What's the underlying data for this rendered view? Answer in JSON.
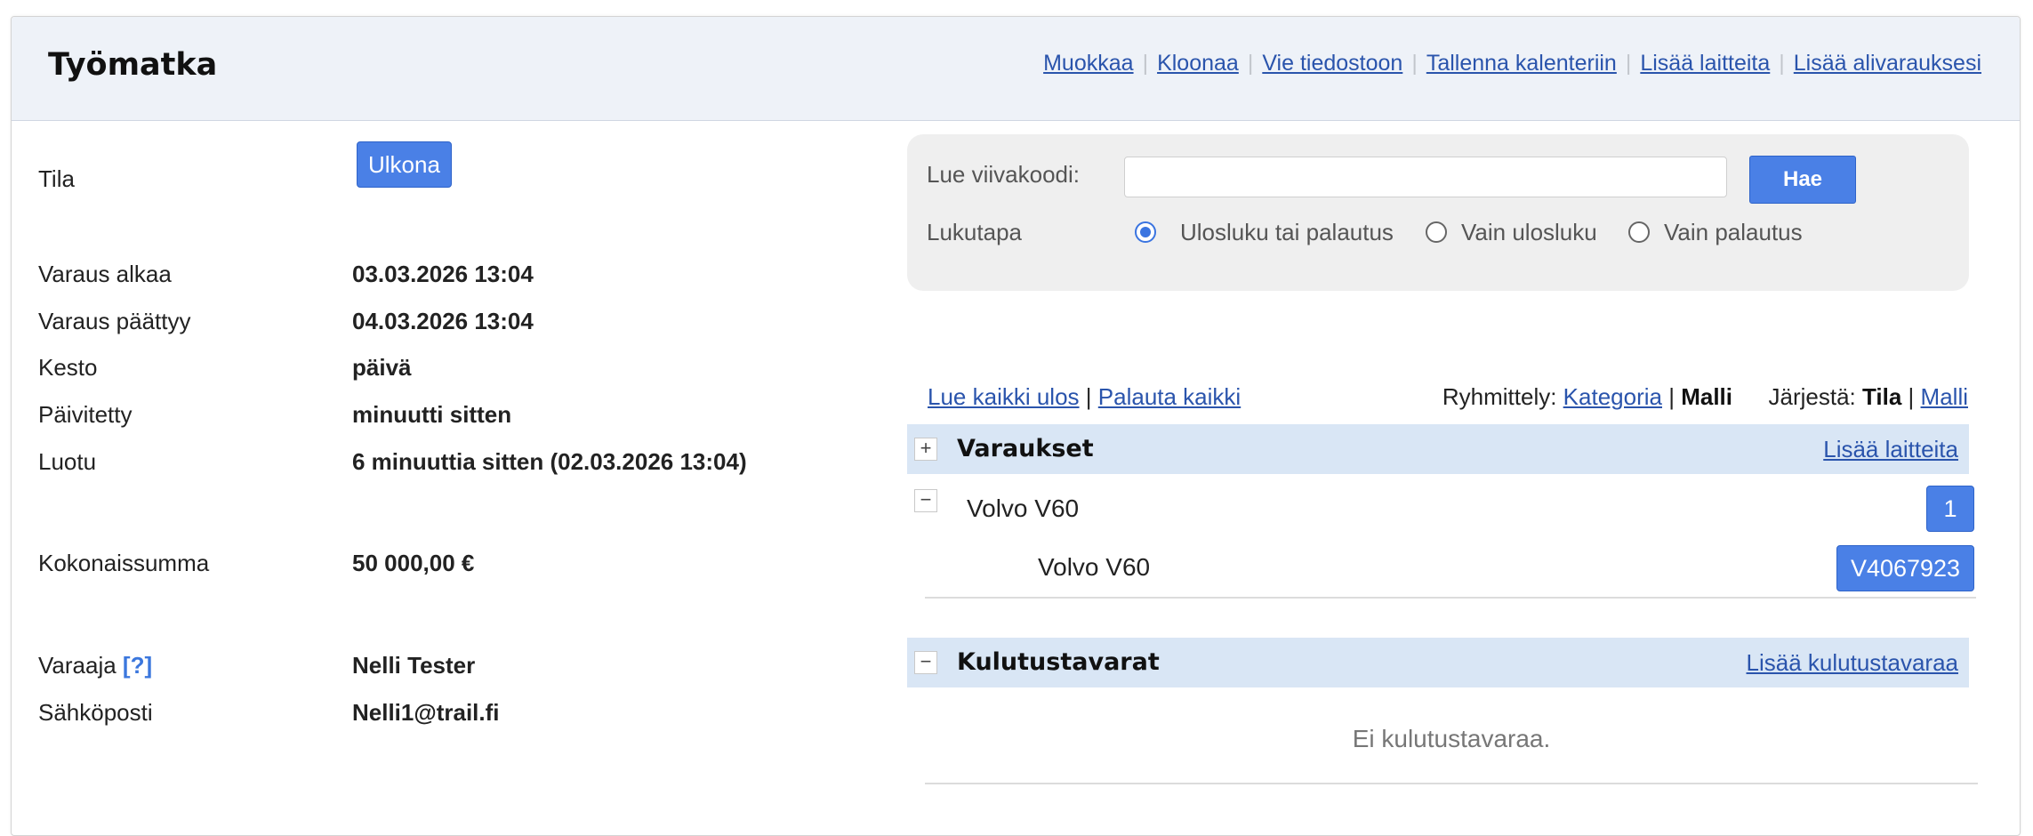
{
  "header": {
    "title": "Työmatka",
    "actions": [
      "Muokkaa",
      "Kloonaa",
      "Vie tiedostoon",
      "Tallenna kalenteriin",
      "Lisää laitteita",
      "Lisää alivarauksesi"
    ]
  },
  "details": {
    "status_label": "Tila",
    "status_value": "Ulkona",
    "start_label": "Varaus alkaa",
    "start_value": "03.03.2026 13:04",
    "end_label": "Varaus päättyy",
    "end_value": "04.03.2026 13:04",
    "duration_label": "Kesto",
    "duration_value": "päivä",
    "updated_label": "Päivitetty",
    "updated_value": "minuutti sitten",
    "created_label": "Luotu",
    "created_value": "6 minuuttia sitten (02.03.2026 13:04)",
    "total_label": "Kokonaissumma",
    "total_value": "50 000,00 €",
    "booker_label": "Varaaja",
    "booker_help": "[?]",
    "booker_value": "Nelli Tester",
    "email_label": "Sähköposti",
    "email_value": "Nelli1@trail.fi"
  },
  "scanner": {
    "barcode_label": "Lue viivakoodi:",
    "barcode_value": "",
    "search_button": "Hae",
    "mode_label": "Lukutapa",
    "modes": [
      "Ulosluku tai palautus",
      "Vain ulosluku",
      "Vain palautus"
    ],
    "selected_mode": "Ulosluku tai palautus"
  },
  "toolbar": {
    "checkout_all": "Lue kaikki ulos",
    "return_all": "Palauta kaikki",
    "divider": "|",
    "grouping_label": "Ryhmittely:",
    "grouping_category": "Kategoria",
    "grouping_model": "Malli",
    "sort_label": "Järjestä:",
    "sort_status": "Tila",
    "sort_model": "Malli"
  },
  "reservations": {
    "toggle": "+",
    "title": "Varaukset",
    "add_link": "Lisää laitteita",
    "group_toggle": "−",
    "group_name": "Volvo V60",
    "group_count": "1",
    "item_name": "Volvo V60",
    "item_code": "V4067923"
  },
  "consumables": {
    "toggle": "−",
    "title": "Kulutustavarat",
    "add_link": "Lisää kulutustavaraa",
    "empty_text": "Ei kulutustavaraa."
  }
}
